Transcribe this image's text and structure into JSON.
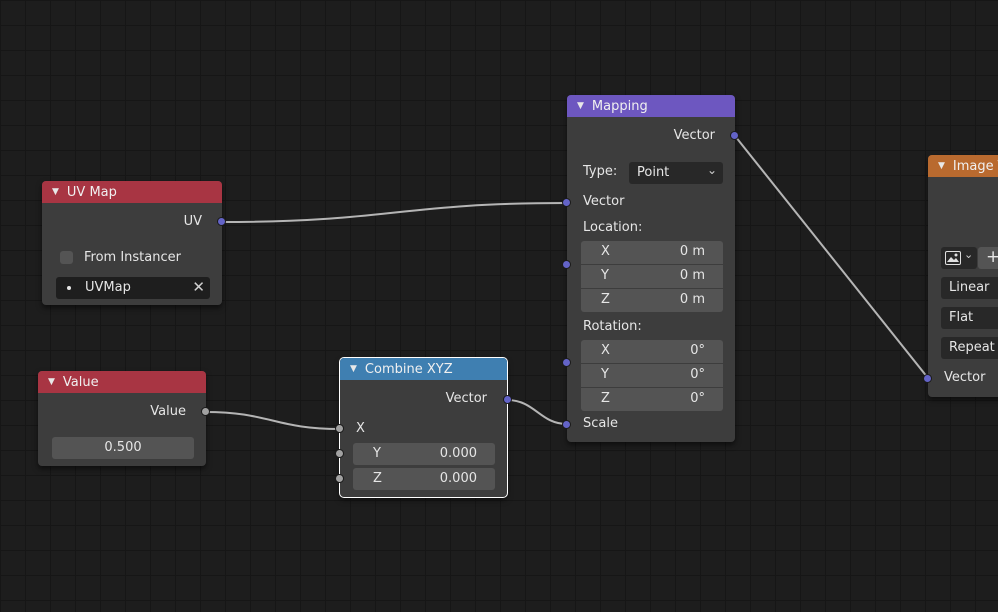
{
  "nodes": {
    "uv_map": {
      "title": "UV Map",
      "header_color": "#a83543",
      "output_uv": "UV",
      "checkbox_label": "From Instancer",
      "uvmap_value": "UVMap"
    },
    "value": {
      "title": "Value",
      "header_color": "#a83543",
      "output_value": "Value",
      "value": "0.500"
    },
    "combine_xyz": {
      "title": "Combine XYZ",
      "header_color": "#3f7fb1",
      "output_vector": "Vector",
      "input_x": "X",
      "y": {
        "label": "Y",
        "value": "0.000"
      },
      "z": {
        "label": "Z",
        "value": "0.000"
      }
    },
    "mapping": {
      "title": "Mapping",
      "header_color": "#6d57c0",
      "output_vector": "Vector",
      "type_label": "Type:",
      "type_value": "Point",
      "input_vector": "Vector",
      "location_label": "Location:",
      "location": [
        {
          "label": "X",
          "value": "0 m"
        },
        {
          "label": "Y",
          "value": "0 m"
        },
        {
          "label": "Z",
          "value": "0 m"
        }
      ],
      "rotation_label": "Rotation:",
      "rotation": [
        {
          "label": "X",
          "value": "0°"
        },
        {
          "label": "Y",
          "value": "0°"
        },
        {
          "label": "Z",
          "value": "0°"
        }
      ],
      "input_scale": "Scale"
    },
    "image_texture": {
      "title": "Image T",
      "header_color": "#b96a2f",
      "plus": "+",
      "interpolation": "Linear",
      "projection": "Flat",
      "extension": "Repeat",
      "input_vector": "Vector"
    }
  },
  "colors": {
    "socket_vector": "#6363c7",
    "socket_float": "#a1a1a1",
    "wire": "#b5b5b5"
  }
}
